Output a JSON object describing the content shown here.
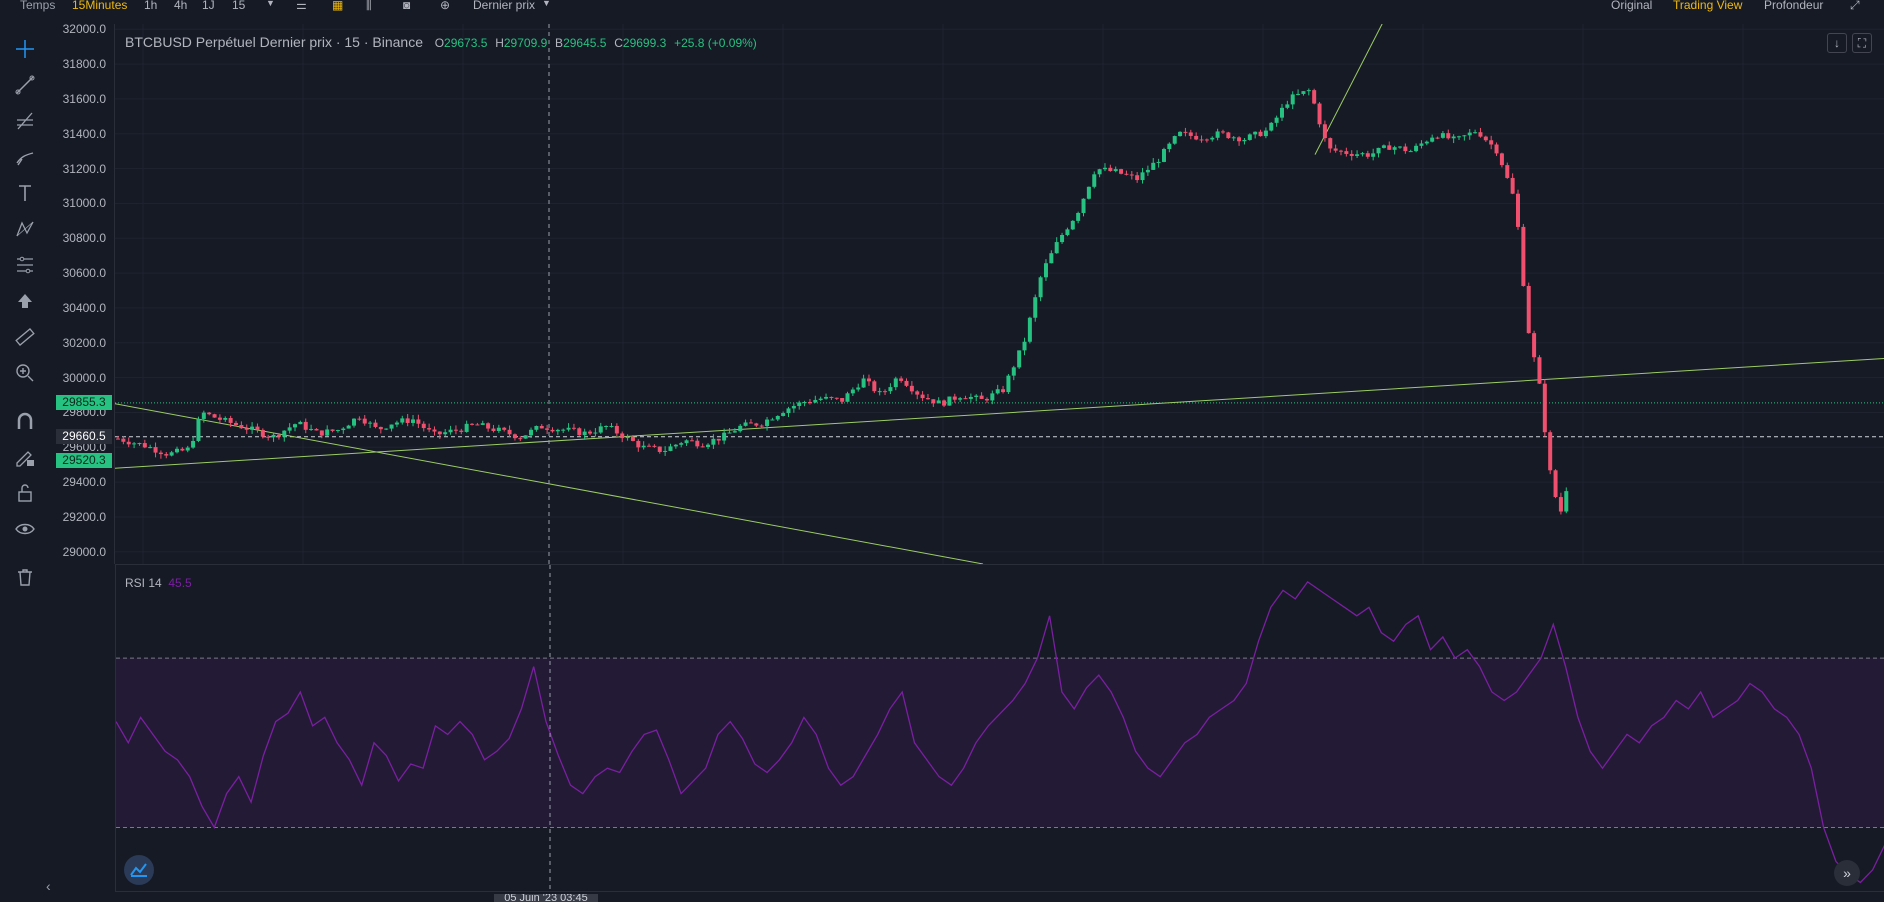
{
  "toolbar": {
    "temps": "Temps",
    "intervals": [
      "15Minutes",
      "1h",
      "4h",
      "1J",
      "15"
    ],
    "price_type": "Dernier prix",
    "views": [
      "Original",
      "Trading View",
      "Profondeur"
    ]
  },
  "legend": {
    "title": "BTCBUSD Perpétuel Dernier prix · 15 · Binance",
    "o_label": "O",
    "o": "29673.5",
    "h_label": "H",
    "h": "29709.9",
    "b_label": "B",
    "b": "29645.5",
    "c_label": "C",
    "c": "29699.3",
    "change": "+25.8 (+0.09%)"
  },
  "rsi": {
    "label": "RSI 14",
    "value": "45.5"
  },
  "price_tags": {
    "upper": "29855.3",
    "current": "29660.5",
    "lower": "29520.3"
  },
  "crosshair_time": "05 Juin '23 03:45",
  "colors": {
    "up": "#26c281",
    "down": "#f0506e",
    "accent": "#f0b90b",
    "rsi": "#7b1fa2",
    "trendline": "#9ccc65",
    "bg": "#161a25"
  },
  "icons": [
    "crosshair-icon",
    "trendline-icon",
    "fib-icon",
    "brush-icon",
    "text-icon",
    "pattern-icon",
    "measure-lines-icon",
    "arrow-up-icon",
    "ruler-icon",
    "zoom-in-icon",
    "magnet-icon",
    "lock-draw-icon",
    "unlock-icon",
    "eye-icon",
    "trash-icon"
  ],
  "chart_data": [
    {
      "type": "candlestick",
      "title": "BTCBUSD Perpétuel Dernier prix · 15 · Binance",
      "ylim": [
        28930,
        32030
      ],
      "yticks": [
        29000,
        29200,
        29400,
        29600,
        29800,
        30000,
        30200,
        30400,
        30600,
        30800,
        31000,
        31200,
        31400,
        31600,
        31800,
        32000
      ],
      "close_path": [
        [
          0,
          29650
        ],
        [
          18,
          29610
        ],
        [
          34,
          29560
        ],
        [
          48,
          29590
        ],
        [
          56,
          29800
        ],
        [
          72,
          29750
        ],
        [
          90,
          29700
        ],
        [
          104,
          29660
        ],
        [
          120,
          29740
        ],
        [
          134,
          29680
        ],
        [
          148,
          29700
        ],
        [
          162,
          29780
        ],
        [
          174,
          29700
        ],
        [
          184,
          29740
        ],
        [
          198,
          29760
        ],
        [
          212,
          29670
        ],
        [
          228,
          29700
        ],
        [
          240,
          29730
        ],
        [
          254,
          29700
        ],
        [
          270,
          29660
        ],
        [
          284,
          29720
        ],
        [
          300,
          29700
        ],
        [
          314,
          29680
        ],
        [
          328,
          29720
        ],
        [
          340,
          29660
        ],
        [
          352,
          29600
        ],
        [
          366,
          29580
        ],
        [
          380,
          29640
        ],
        [
          392,
          29620
        ],
        [
          406,
          29660
        ],
        [
          418,
          29720
        ],
        [
          432,
          29740
        ],
        [
          448,
          29820
        ],
        [
          460,
          29860
        ],
        [
          472,
          29880
        ],
        [
          486,
          29870
        ],
        [
          500,
          29990
        ],
        [
          512,
          29900
        ],
        [
          524,
          30010
        ],
        [
          538,
          29900
        ],
        [
          552,
          29850
        ],
        [
          566,
          29900
        ],
        [
          580,
          29870
        ],
        [
          594,
          29930
        ],
        [
          608,
          30200
        ],
        [
          620,
          30600
        ],
        [
          632,
          30800
        ],
        [
          644,
          30950
        ],
        [
          656,
          31200
        ],
        [
          670,
          31180
        ],
        [
          684,
          31140
        ],
        [
          698,
          31250
        ],
        [
          712,
          31400
        ],
        [
          726,
          31380
        ],
        [
          740,
          31400
        ],
        [
          756,
          31370
        ],
        [
          772,
          31420
        ],
        [
          786,
          31600
        ],
        [
          800,
          31650
        ],
        [
          812,
          31310
        ],
        [
          826,
          31290
        ],
        [
          840,
          31280
        ],
        [
          854,
          31330
        ],
        [
          868,
          31300
        ],
        [
          884,
          31400
        ],
        [
          898,
          31360
        ],
        [
          912,
          31420
        ],
        [
          926,
          31300
        ],
        [
          938,
          31000
        ],
        [
          946,
          30300
        ],
        [
          954,
          29950
        ],
        [
          962,
          29400
        ],
        [
          968,
          29220
        ],
        [
          975,
          29470
        ]
      ],
      "x_scale": 1.49,
      "support_lines": [
        29855.3,
        29520.3
      ],
      "current_price": 29660.5
    },
    {
      "type": "line",
      "title": "RSI 14",
      "ylim": [
        15,
        92
      ],
      "bands": [
        30,
        70
      ],
      "series": [
        {
          "name": "RSI 14",
          "values": [
            55,
            50,
            56,
            52,
            48,
            46,
            42,
            35,
            30,
            38,
            42,
            36,
            47,
            55,
            57,
            62,
            54,
            56,
            50,
            46,
            40,
            50,
            47,
            41,
            45,
            44,
            54,
            52,
            55,
            52,
            46,
            48,
            51,
            58,
            68,
            55,
            47,
            40,
            38,
            42,
            44,
            43,
            48,
            52,
            53,
            46,
            38,
            41,
            44,
            52,
            55,
            51,
            45,
            43,
            46,
            50,
            56,
            52,
            44,
            40,
            42,
            47,
            52,
            58,
            62,
            50,
            46,
            42,
            40,
            44,
            50,
            54,
            57,
            60,
            64,
            70,
            80,
            62,
            58,
            63,
            66,
            62,
            56,
            48,
            44,
            42,
            46,
            50,
            52,
            56,
            58,
            60,
            64,
            74,
            82,
            86,
            84,
            88,
            86,
            84,
            82,
            80,
            82,
            76,
            74,
            78,
            80,
            72,
            75,
            70,
            72,
            68,
            62,
            60,
            62,
            66,
            70,
            78,
            68,
            56,
            48,
            44,
            48,
            52,
            50,
            54,
            56,
            60,
            58,
            62,
            56,
            58,
            60,
            64,
            62,
            58,
            56,
            52,
            44,
            30,
            22,
            19,
            17,
            20,
            26
          ]
        }
      ]
    }
  ]
}
